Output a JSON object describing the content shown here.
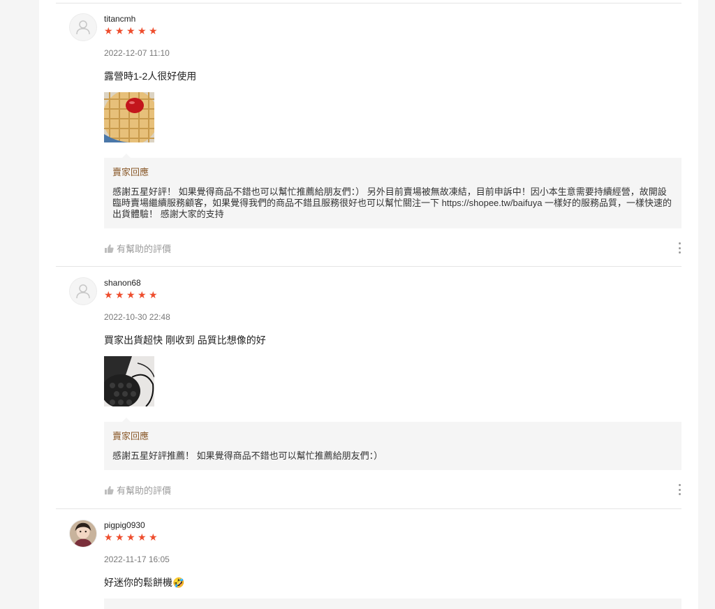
{
  "reviews": [
    {
      "username": "titancmh",
      "rating": 5,
      "date": "2022-12-07 11:10",
      "comment": "露營時1-2人很好使用",
      "reply_title": "賣家回應",
      "reply_text": "感謝五星好評！ 如果覺得商品不錯也可以幫忙推薦給朋友們：） 另外目前賣場被無故凍結，目前申訴中！因小本生意需要持續經營，故開設臨時賣場繼續服務顧客，如果覺得我們的商品不錯且服務很好也可以幫忙關注一下 https://shopee.tw/baifuya 一樣好的服務品質，一樣快速的出貨體驗！ 感謝大家的支持",
      "helpful_label": "有幫助的評價"
    },
    {
      "username": "shanon68",
      "rating": 5,
      "date": "2022-10-30 22:48",
      "comment": "買家出貨超快 剛收到 品質比想像的好",
      "reply_title": "賣家回應",
      "reply_text": "感謝五星好評推薦！ 如果覺得商品不錯也可以幫忙推薦給朋友們：）",
      "helpful_label": "有幫助的評價"
    },
    {
      "username": "pigpig0930",
      "rating": 5,
      "date": "2022-11-17 16:05",
      "comment": "好迷你的鬆餅機🤣"
    }
  ],
  "colors": {
    "star": "#ee4d2d",
    "reply_title": "#8a5a2b",
    "reply_bg": "#f5f5f5"
  }
}
